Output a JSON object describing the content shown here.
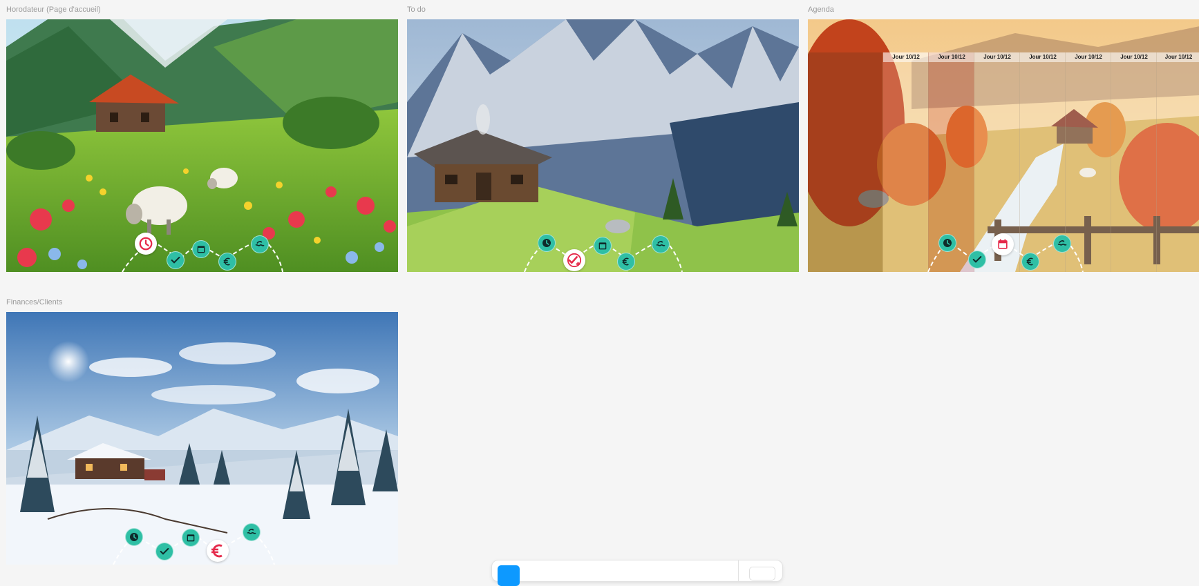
{
  "frames": [
    {
      "id": "horodateur",
      "label": "Horodateur (Page d'accueil)",
      "scene": "alpine spring meadow with chalet, sheep and flowers",
      "active_nav": "clock"
    },
    {
      "id": "todo",
      "label": "To do",
      "scene": "snowy peaks above a wooden mountain cabin",
      "active_nav": "todo"
    },
    {
      "id": "agenda",
      "label": "Agenda",
      "scene": "autumn valley with stream, cabin and sheep",
      "active_nav": "calendar",
      "day_headers": [
        "Jour 10/12",
        "Jour 10/12",
        "Jour 10/12",
        "Jour 10/12",
        "Jour 10/12",
        "Jour 10/12",
        "Jour 10/12"
      ]
    },
    {
      "id": "finances",
      "label": "Finances/Clients",
      "scene": "winter landscape with snowy cabin and pine trees",
      "active_nav": "euro"
    }
  ],
  "nav_items": [
    {
      "key": "clock",
      "icon": "clock-icon"
    },
    {
      "key": "todo",
      "icon": "check-add-icon"
    },
    {
      "key": "calendar",
      "icon": "calendar-icon"
    },
    {
      "key": "euro",
      "icon": "euro-icon"
    },
    {
      "key": "clients",
      "icon": "waves-icon"
    }
  ],
  "colors": {
    "nav_teal": "#2fbfa5",
    "active_red": "#e5294a",
    "canvas_bg": "#f5f5f5",
    "label_gray": "#9b9b9b",
    "toolbar_blue": "#0d99ff"
  }
}
